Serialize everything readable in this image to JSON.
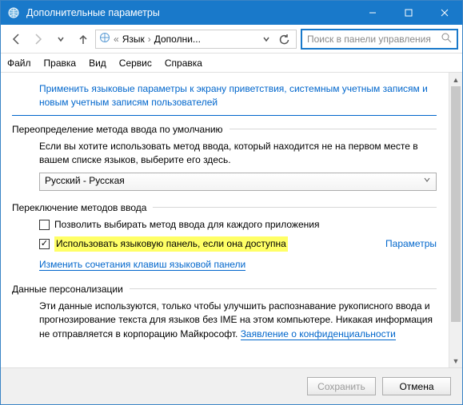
{
  "title": "Дополнительные параметры",
  "breadcrumb": {
    "item1": "Язык",
    "item2": "Дополни..."
  },
  "search": {
    "placeholder": "Поиск в панели управления"
  },
  "menu": {
    "file": "Файл",
    "edit": "Правка",
    "view": "Вид",
    "tools": "Сервис",
    "help": "Справка"
  },
  "toplink": "Применить языковые параметры к экрану приветствия, системным учетным записям и новым учетным записям пользователей",
  "section1": {
    "title": "Переопределение метода ввода по умолчанию",
    "body": "Если вы хотите использовать метод ввода, который находится не на первом месте в вашем списке языков, выберите его здесь.",
    "dropdown": "Русский - Русская"
  },
  "section2": {
    "title": "Переключение методов ввода",
    "check1": "Позволить выбирать метод ввода для каждого приложения",
    "check2": "Использовать языковую панель, если она доступна",
    "paramslink": "Параметры",
    "link2": "Изменить сочетания клавиш языковой панели"
  },
  "section3": {
    "title": "Данные персонализации",
    "body": "Эти данные используются, только чтобы улучшить распознавание рукописного ввода и прогнозирование текста для языков без IME на этом компьютере. Никакая информация не отправляется в корпорацию Майкрософт. ",
    "link": "Заявление о конфиденциальности"
  },
  "buttons": {
    "save": "Сохранить",
    "cancel": "Отмена"
  }
}
